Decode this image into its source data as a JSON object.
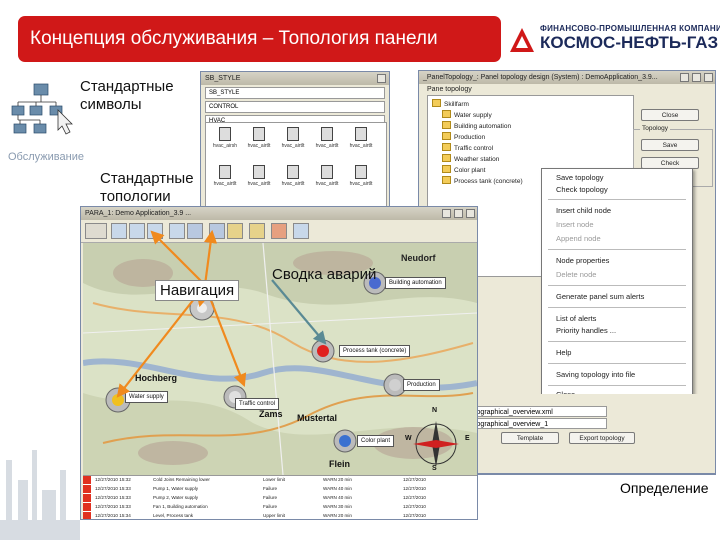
{
  "header": {
    "title": "Концепция обслуживания – Топология панели",
    "company_top": "ФИНАНСОВО-ПРОМЫШЛЕННАЯ КОМПАНИЯ",
    "company_main": "КОСМОС-НЕФТЬ-ГАЗ",
    "accent_color": "#d01818",
    "brand_color": "#1c2a5a"
  },
  "labels": {
    "standard_symbols": "Стандартные символы",
    "standard_topologies": "Стандартные топологии",
    "service": "Обслуживание",
    "definition": "Определение",
    "navigation": "Навигация",
    "alarm_summary": "Сводка аварий"
  },
  "symbols_window": {
    "title": "SB_STYLE",
    "field_1": "SB_STYLE",
    "field_2": "CONTROL",
    "field_3": "HVAC",
    "items": [
      {
        "label": "hvac_airsh"
      },
      {
        "label": "hvac_airtlt"
      },
      {
        "label": "hvac_airtlt"
      },
      {
        "label": "hvac_airtlt"
      },
      {
        "label": "hvac_airtlt"
      },
      {
        "label": "hvac_airtlt"
      },
      {
        "label": "hvac_airtlt"
      },
      {
        "label": "hvac_airtlt"
      },
      {
        "label": "hvac_airtlt"
      },
      {
        "label": "hvac_airtlt"
      }
    ]
  },
  "topology_window": {
    "title": "_PanelTopology_: Panel topology design (System) : DemoApplication_3.9...",
    "tree_title": "Pane topology",
    "tree_items": [
      "Skillfarm",
      "Water supply",
      "Building automation",
      "Production",
      "Traffic control",
      "Weather station",
      "Color plant",
      "Process tank (concrete)"
    ],
    "buttons": {
      "close": "Close",
      "save": "Save",
      "check": "Check",
      "template": "Template",
      "export_topology": "Export topology"
    },
    "group_topology": "Topology",
    "list_items": [
      "mainpanels/geographical_overview.xml",
      "mainpanels/geographical_overview_1"
    ]
  },
  "context_menu": {
    "items": [
      {
        "label": "Save topology",
        "enabled": true
      },
      {
        "label": "Check topology",
        "enabled": true
      },
      {
        "label": "Insert child node",
        "enabled": true
      },
      {
        "label": "Insert node",
        "enabled": false
      },
      {
        "label": "Append node",
        "enabled": false
      },
      {
        "label": "Node properties",
        "enabled": true
      },
      {
        "label": "Delete node",
        "enabled": false
      },
      {
        "label": "Generate panel sum alerts",
        "enabled": true
      },
      {
        "label": "List of alerts",
        "enabled": true
      },
      {
        "label": "Priority handles ...",
        "enabled": true
      },
      {
        "label": "Help",
        "enabled": true
      },
      {
        "label": "Saving topology into file",
        "enabled": true
      },
      {
        "label": "Close",
        "enabled": true
      }
    ]
  },
  "map_window": {
    "title": "PARA_1: Demo Application_3.9 ...",
    "places": {
      "neudorf": "Neudorf",
      "hochberg": "Hochberg",
      "zams": "Zams",
      "flein": "Flein",
      "mustertal": "Mustertal"
    },
    "objects": {
      "building_automation": "Building automation",
      "water_supply": "Water supply",
      "traffic_control": "Traffic control",
      "production": "Production",
      "color_plant": "Color plant",
      "process_tank": "Process tank (concrete)"
    },
    "compass": {
      "n": "N",
      "s": "S",
      "w": "W",
      "e": "E"
    },
    "alarm_rows": [
      {
        "col1": "12/27/2010 15:32",
        "col2": "Cold Joins Remaining lower",
        "col3": "Lower limit",
        "col4": "WARN 20 min",
        "col5": "12/27/2010"
      },
      {
        "col1": "12/27/2010 15:33",
        "col2": "Pump 1, Water supply",
        "col3": "Failure",
        "col4": "WARN 40 min",
        "col5": "12/27/2010"
      },
      {
        "col1": "12/27/2010 15:33",
        "col2": "Pump 2, Water supply",
        "col3": "Failure",
        "col4": "WARN 40 min",
        "col5": "12/27/2010"
      },
      {
        "col1": "12/27/2010 15:33",
        "col2": "Fan 1, Building automation",
        "col3": "Failure",
        "col4": "WARN 30 min",
        "col5": "12/27/2010"
      },
      {
        "col1": "12/27/2010 15:34",
        "col2": "Level, Process tank",
        "col3": "Upper limit",
        "col4": "WARN 20 min",
        "col5": "12/27/2010"
      }
    ]
  }
}
